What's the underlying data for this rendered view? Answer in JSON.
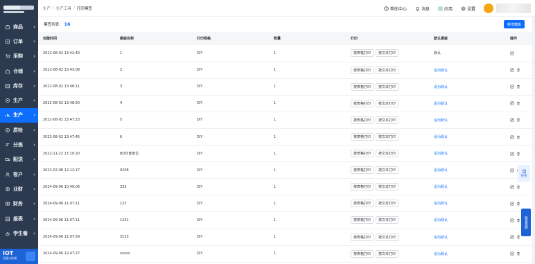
{
  "sidebar": {
    "items": [
      {
        "label": "商品",
        "icon": "shop-icon"
      },
      {
        "label": "订单",
        "icon": "order-icon"
      },
      {
        "label": "采购",
        "icon": "cart-icon"
      },
      {
        "label": "仓储",
        "icon": "warehouse-icon"
      },
      {
        "label": "库存",
        "icon": "inventory-icon"
      },
      {
        "label": "生产",
        "icon": "production-icon"
      },
      {
        "label": "生产",
        "icon": "chart-icon",
        "active": true
      },
      {
        "label": "质检",
        "icon": "quality-icon"
      },
      {
        "label": "分拣",
        "icon": "sort-icon"
      },
      {
        "label": "配送",
        "icon": "delivery-icon"
      },
      {
        "label": "客户",
        "icon": "customer-icon"
      },
      {
        "label": "业财",
        "icon": "finance-icon"
      },
      {
        "label": "财务",
        "icon": "money-icon"
      },
      {
        "label": "报表",
        "icon": "report-icon"
      },
      {
        "label": "学生餐",
        "icon": "meal-icon"
      }
    ],
    "footer": {
      "title": "IOT",
      "subtitle": "设备与终端"
    }
  },
  "breadcrumb": [
    "生产",
    "生产工具",
    "打印模签"
  ],
  "topnav": {
    "help": "帮助中心",
    "messages": "消息",
    "apps": "应用",
    "settings": "设置"
  },
  "toolbar": {
    "count_label": "模签列表：",
    "count": "16",
    "new_button": "新增模板"
  },
  "table": {
    "headers": [
      "创建时间",
      "模板名称",
      "打印规格",
      "数量",
      "打印",
      "默认模板",
      "操作"
    ],
    "print_buttons": [
      "按表格打印",
      "按文本打印"
    ],
    "rows": [
      {
        "time": "2022-08-02 13:42:40",
        "name": "1",
        "spec": "DIY",
        "qty": "1",
        "default": "默认",
        "is_default": true
      },
      {
        "time": "2022-08-02 13:43:08",
        "name": "2",
        "spec": "DIY",
        "qty": "1",
        "default": "设为默认",
        "is_default": false
      },
      {
        "time": "2022-08-02 13:46:11",
        "name": "3",
        "spec": "DIY",
        "qty": "1",
        "default": "设为默认",
        "is_default": false
      },
      {
        "time": "2022-08-02 13:46:50",
        "name": "4",
        "spec": "DIY",
        "qty": "1",
        "default": "设为默认",
        "is_default": false
      },
      {
        "time": "2022-08-02 13:47:23",
        "name": "5",
        "spec": "DIY",
        "qty": "1",
        "default": "设为默认",
        "is_default": false
      },
      {
        "time": "2022-08-02 13:47:45",
        "name": "6",
        "spec": "DIY",
        "qty": "1",
        "default": "设为默认",
        "is_default": false
      },
      {
        "time": "2022-11-22 17:10:20",
        "name": "BD伙食单位",
        "spec": "DIY",
        "qty": "1",
        "default": "设为默认",
        "is_default": false
      },
      {
        "time": "2023-02-08 12:12:17",
        "name": "0208",
        "spec": "DIY",
        "qty": "1",
        "default": "设为默认",
        "is_default": false
      },
      {
        "time": "2024-09-06 10:49:06",
        "name": "333",
        "spec": "DIY",
        "qty": "1",
        "default": "设为默认",
        "is_default": false
      },
      {
        "time": "2024-09-06 11:07:11",
        "name": "123",
        "spec": "DIY",
        "qty": "1",
        "default": "设为默认",
        "is_default": false
      },
      {
        "time": "2024-09-06 11:07:11",
        "name": "1231",
        "spec": "DIY",
        "qty": "1",
        "default": "设为默认",
        "is_default": false
      },
      {
        "time": "2024-09-06 11:07:59",
        "name": "3123",
        "spec": "DIY",
        "qty": "1",
        "default": "设为默认",
        "is_default": false
      },
      {
        "time": "2024-09-06 12:47:27",
        "name": "xxxxx",
        "spec": "DIY",
        "qty": "1",
        "default": "设为默认",
        "is_default": false
      }
    ]
  },
  "floating": {
    "task": "任务",
    "service": "联系客服"
  }
}
